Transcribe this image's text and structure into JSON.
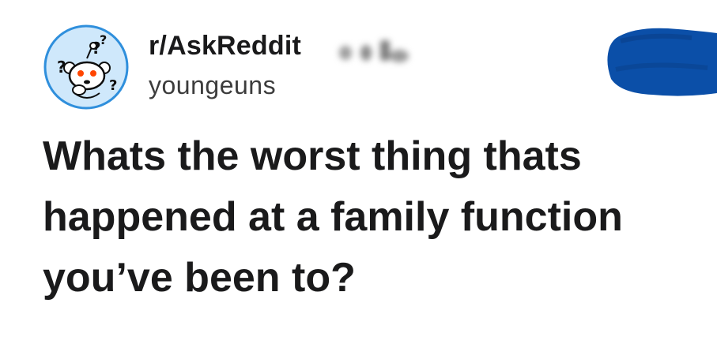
{
  "post": {
    "subreddit": "r/AskReddit",
    "username": "youngeuns",
    "title": "Whats the worst thing thats happened at a family function you’ve been to?"
  },
  "icons": {
    "avatar": "askreddit-snoo-icon",
    "badge": "blurred-badge-icon",
    "join": "join-button-scribble"
  },
  "colors": {
    "avatar_bg": "#cfe8fb",
    "avatar_ring": "#2f8fdc",
    "text": "#1a1a1b",
    "join_blob": "#0b4fa8"
  }
}
